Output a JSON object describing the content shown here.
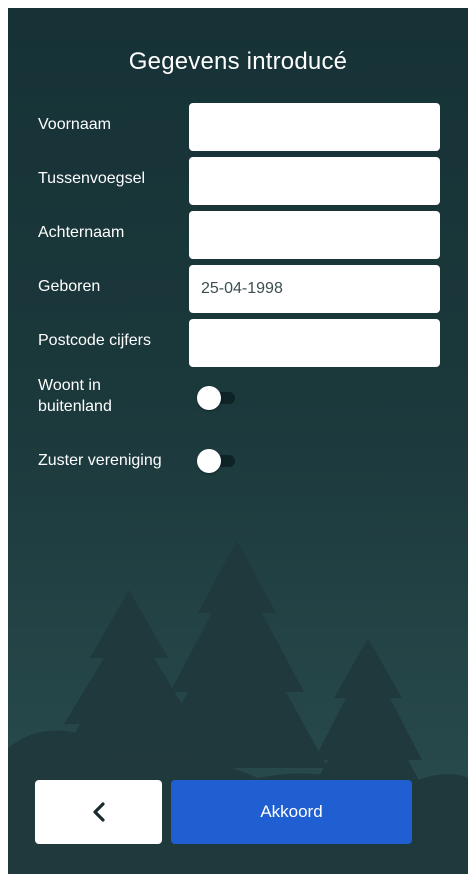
{
  "colors": {
    "background_top": "#163236",
    "background_bottom": "#2b4e50",
    "trees": "#20393c",
    "accent_button": "#1f5fd1",
    "input_background": "#ffffff"
  },
  "header": {
    "title": "Gegevens introducé"
  },
  "form": {
    "voornaam": {
      "label": "Voornaam",
      "value": ""
    },
    "tussenvoegsel": {
      "label": "Tussenvoegsel",
      "value": ""
    },
    "achternaam": {
      "label": "Achternaam",
      "value": ""
    },
    "geboren": {
      "label": "Geboren",
      "value": "25-04-1998"
    },
    "postcode": {
      "label": "Postcode cijfers",
      "value": ""
    },
    "woont_in_buitenland": {
      "label_line1": "Woont in",
      "label_line2": "buitenland",
      "checked": false
    },
    "zuster_vereniging": {
      "label": "Zuster vereniging",
      "checked": false
    }
  },
  "footer": {
    "back_icon": "chevron-left-icon",
    "ok_label": "Akkoord"
  }
}
